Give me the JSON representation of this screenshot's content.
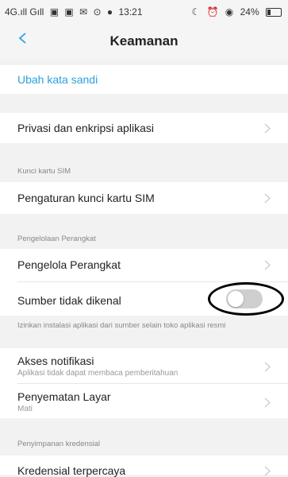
{
  "status_bar": {
    "signal_left": "4G.ıll Gıll",
    "notif_icons": [
      "▣",
      "▣",
      "✉",
      "⊙",
      "●"
    ],
    "time": "13:21",
    "right_icons": [
      "☾",
      "⏰",
      "◉"
    ],
    "battery": "24%"
  },
  "header": {
    "title": "Keamanan"
  },
  "rows": {
    "change_password": "Ubah kata sandi",
    "privacy": "Privasi dan enkripsi aplikasi",
    "sim_section": "Kunci kartu SIM",
    "sim_lock": "Pengaturan kunci kartu SIM",
    "device_section": "Pengelolaan Perangkat",
    "device_admin": "Pengelola Perangkat",
    "unknown_sources": "Sumber tidak dikenal",
    "unknown_sources_note": "Izinkan instalasi aplikasi dari sumber selain toko aplikasi resmi",
    "notif_access": "Akses notifikasi",
    "notif_access_sub": "Aplikasi tidak dapat membaca pemberitahuan",
    "screen_pinning": "Penyematan Layar",
    "screen_pinning_sub": "Mati",
    "credential_section": "Penyimpanan kredensial",
    "trusted_credentials": "Kredensial terpercaya"
  },
  "toggle_unknown_sources": {
    "on": false
  },
  "colors": {
    "accent": "#2aa1e0",
    "toggle_off": "#cfcfcf",
    "annotation": "#000000"
  }
}
